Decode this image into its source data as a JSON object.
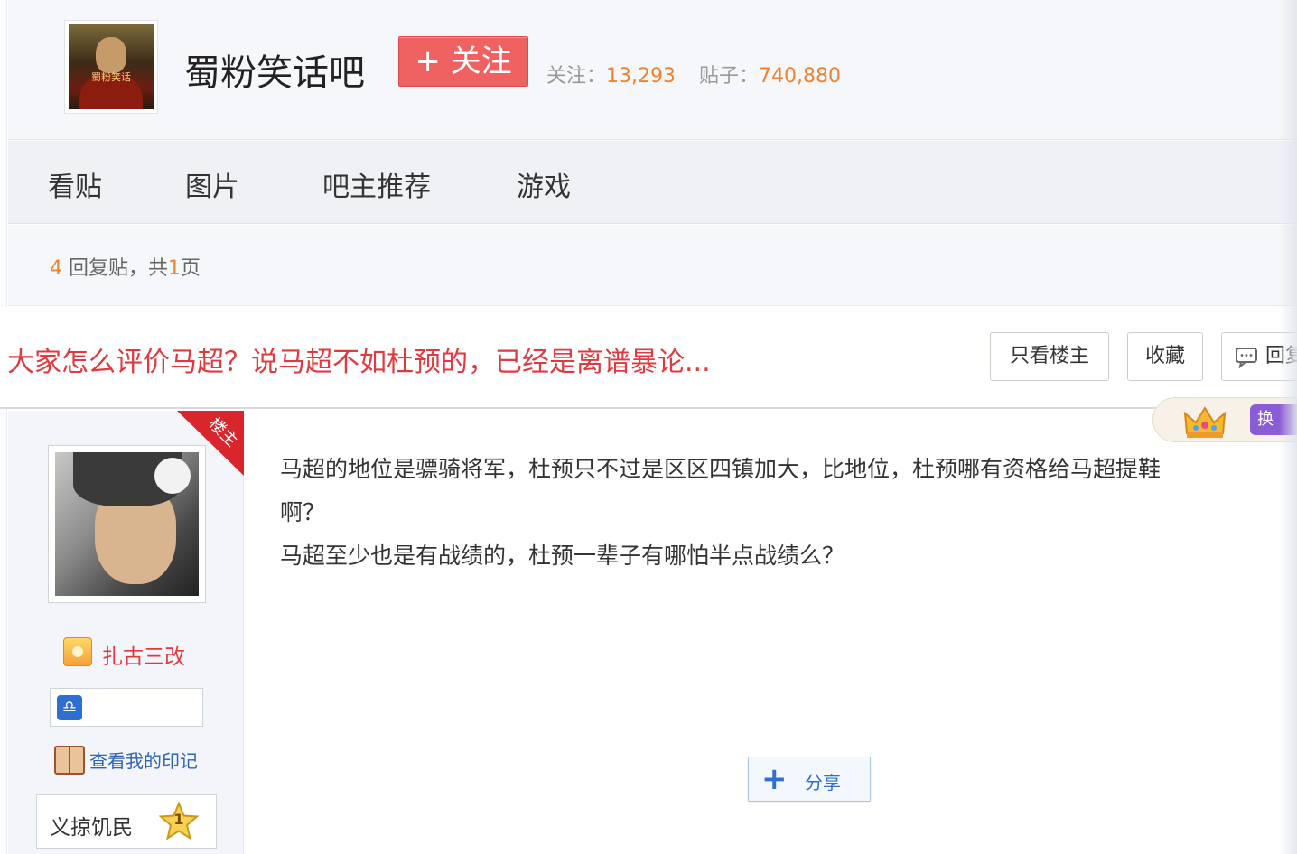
{
  "header": {
    "bar_name": "蜀粉笑话吧",
    "logo_text": "蜀粉笑话",
    "follow_label": "+ 关注",
    "follow_count_label": "关注：",
    "follow_count": "13,293",
    "post_count_label": "贴子：",
    "post_count": "740,880"
  },
  "nav": {
    "items": [
      {
        "label": "看贴"
      },
      {
        "label": "图片"
      },
      {
        "label": "吧主推荐"
      },
      {
        "label": "游戏"
      }
    ]
  },
  "thread_meta": {
    "reply_count": "4",
    "reply_text": "回复贴，共",
    "page_count": "1",
    "page_unit": "页"
  },
  "thread": {
    "title": "大家怎么评价马超？说马超不如杜预的，已经是离谱暴论...",
    "buttons": {
      "only_op": "只看楼主",
      "favorite": "收藏",
      "reply": "回复"
    }
  },
  "post": {
    "op_badge": "楼主",
    "username": "扎古三改",
    "view_marks": "查看我的印记",
    "rank_title": "义掠饥民",
    "rank_level": "1",
    "body_line1": "马超的地位是骠骑将军，杜预只不过是区区四镇加大，比地位，杜预哪有资格给马超提鞋",
    "body_line2": "啊？",
    "body_line3": "马超至少也是有战绩的，杜预一辈子有哪怕半点战绩么？",
    "share_label": "分享",
    "purple_badge": "换"
  },
  "colors": {
    "title_red": "#e0393e",
    "count_orange": "#f0822f",
    "follow_button": "#f06262",
    "link_blue": "#2d64b3"
  }
}
